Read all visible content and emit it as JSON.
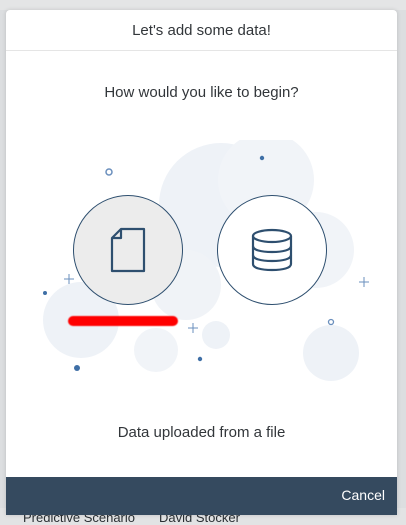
{
  "dialog": {
    "title": "Let's add some data!",
    "prompt": "How would you like to begin?",
    "options": [
      {
        "icon": "file-icon",
        "selected": true
      },
      {
        "icon": "database-icon",
        "selected": false
      }
    ],
    "selected_description": "Data uploaded from a file",
    "cancel_label": "Cancel"
  },
  "background": {
    "row_cells": [
      "Predictive Scenario",
      "David Stocker"
    ]
  },
  "colors": {
    "footer": "#354a5f",
    "icon_stroke": "#2e4f6f",
    "redaction": "#ff0000",
    "decor_dots": "#3f6fa6"
  }
}
